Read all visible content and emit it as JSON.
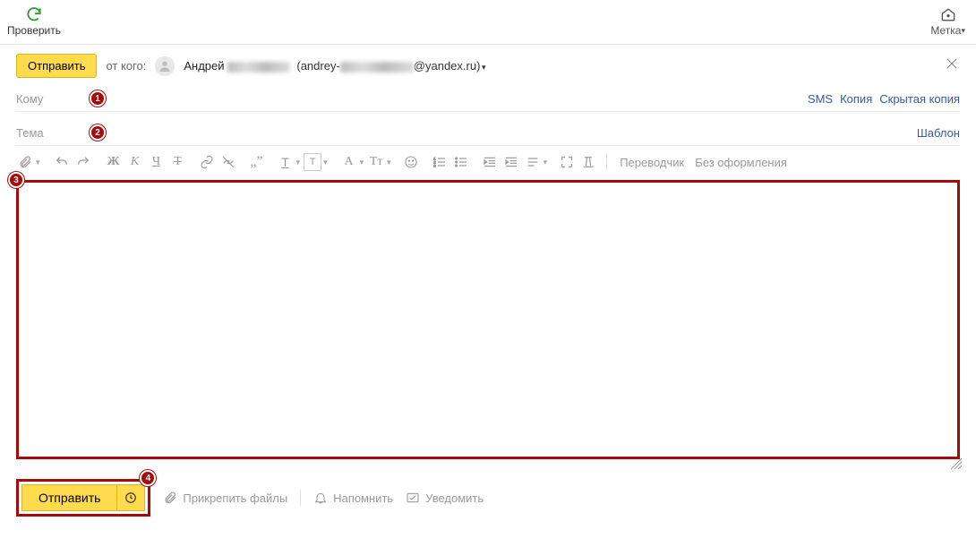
{
  "top": {
    "check_label": "Проверить",
    "label_label": "Метка"
  },
  "compose": {
    "send_label": "Отправить",
    "from_label": "от кого:",
    "from_name": "Андрей",
    "email_prefix": "(andrey-",
    "email_suffix": "@yandex.ru)"
  },
  "to_row": {
    "label": "Кому",
    "link_sms": "SMS",
    "link_cc": "Копия",
    "link_bcc": "Скрытая копия"
  },
  "subject_row": {
    "label": "Тема",
    "link_template": "Шаблон"
  },
  "toolbar": {
    "bold": "Ж",
    "italic": "К",
    "underline": "Ч",
    "strike": "Т",
    "font_size": "A",
    "font_family": "Тт",
    "text1": "Т",
    "translator": "Переводчик",
    "no_formatting": "Без оформления"
  },
  "bottom": {
    "send_label": "Отправить",
    "attach_label": "Прикрепить файлы",
    "remind_label": "Напомнить",
    "notify_label": "Уведомить"
  },
  "annotations": {
    "b1": "1",
    "b2": "2",
    "b3": "3",
    "b4": "4"
  }
}
